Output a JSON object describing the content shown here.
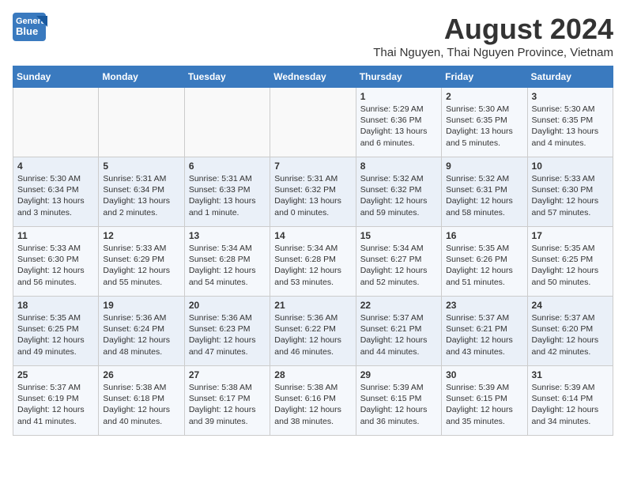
{
  "header": {
    "logo_general": "General",
    "logo_blue": "Blue",
    "main_title": "August 2024",
    "subtitle": "Thai Nguyen, Thai Nguyen Province, Vietnam"
  },
  "calendar": {
    "days_of_week": [
      "Sunday",
      "Monday",
      "Tuesday",
      "Wednesday",
      "Thursday",
      "Friday",
      "Saturday"
    ],
    "weeks": [
      [
        {
          "day": "",
          "info": ""
        },
        {
          "day": "",
          "info": ""
        },
        {
          "day": "",
          "info": ""
        },
        {
          "day": "",
          "info": ""
        },
        {
          "day": "1",
          "info": "Sunrise: 5:29 AM\nSunset: 6:36 PM\nDaylight: 13 hours\nand 6 minutes."
        },
        {
          "day": "2",
          "info": "Sunrise: 5:30 AM\nSunset: 6:35 PM\nDaylight: 13 hours\nand 5 minutes."
        },
        {
          "day": "3",
          "info": "Sunrise: 5:30 AM\nSunset: 6:35 PM\nDaylight: 13 hours\nand 4 minutes."
        }
      ],
      [
        {
          "day": "4",
          "info": "Sunrise: 5:30 AM\nSunset: 6:34 PM\nDaylight: 13 hours\nand 3 minutes."
        },
        {
          "day": "5",
          "info": "Sunrise: 5:31 AM\nSunset: 6:34 PM\nDaylight: 13 hours\nand 2 minutes."
        },
        {
          "day": "6",
          "info": "Sunrise: 5:31 AM\nSunset: 6:33 PM\nDaylight: 13 hours\nand 1 minute."
        },
        {
          "day": "7",
          "info": "Sunrise: 5:31 AM\nSunset: 6:32 PM\nDaylight: 13 hours\nand 0 minutes."
        },
        {
          "day": "8",
          "info": "Sunrise: 5:32 AM\nSunset: 6:32 PM\nDaylight: 12 hours\nand 59 minutes."
        },
        {
          "day": "9",
          "info": "Sunrise: 5:32 AM\nSunset: 6:31 PM\nDaylight: 12 hours\nand 58 minutes."
        },
        {
          "day": "10",
          "info": "Sunrise: 5:33 AM\nSunset: 6:30 PM\nDaylight: 12 hours\nand 57 minutes."
        }
      ],
      [
        {
          "day": "11",
          "info": "Sunrise: 5:33 AM\nSunset: 6:30 PM\nDaylight: 12 hours\nand 56 minutes."
        },
        {
          "day": "12",
          "info": "Sunrise: 5:33 AM\nSunset: 6:29 PM\nDaylight: 12 hours\nand 55 minutes."
        },
        {
          "day": "13",
          "info": "Sunrise: 5:34 AM\nSunset: 6:28 PM\nDaylight: 12 hours\nand 54 minutes."
        },
        {
          "day": "14",
          "info": "Sunrise: 5:34 AM\nSunset: 6:28 PM\nDaylight: 12 hours\nand 53 minutes."
        },
        {
          "day": "15",
          "info": "Sunrise: 5:34 AM\nSunset: 6:27 PM\nDaylight: 12 hours\nand 52 minutes."
        },
        {
          "day": "16",
          "info": "Sunrise: 5:35 AM\nSunset: 6:26 PM\nDaylight: 12 hours\nand 51 minutes."
        },
        {
          "day": "17",
          "info": "Sunrise: 5:35 AM\nSunset: 6:25 PM\nDaylight: 12 hours\nand 50 minutes."
        }
      ],
      [
        {
          "day": "18",
          "info": "Sunrise: 5:35 AM\nSunset: 6:25 PM\nDaylight: 12 hours\nand 49 minutes."
        },
        {
          "day": "19",
          "info": "Sunrise: 5:36 AM\nSunset: 6:24 PM\nDaylight: 12 hours\nand 48 minutes."
        },
        {
          "day": "20",
          "info": "Sunrise: 5:36 AM\nSunset: 6:23 PM\nDaylight: 12 hours\nand 47 minutes."
        },
        {
          "day": "21",
          "info": "Sunrise: 5:36 AM\nSunset: 6:22 PM\nDaylight: 12 hours\nand 46 minutes."
        },
        {
          "day": "22",
          "info": "Sunrise: 5:37 AM\nSunset: 6:21 PM\nDaylight: 12 hours\nand 44 minutes."
        },
        {
          "day": "23",
          "info": "Sunrise: 5:37 AM\nSunset: 6:21 PM\nDaylight: 12 hours\nand 43 minutes."
        },
        {
          "day": "24",
          "info": "Sunrise: 5:37 AM\nSunset: 6:20 PM\nDaylight: 12 hours\nand 42 minutes."
        }
      ],
      [
        {
          "day": "25",
          "info": "Sunrise: 5:37 AM\nSunset: 6:19 PM\nDaylight: 12 hours\nand 41 minutes."
        },
        {
          "day": "26",
          "info": "Sunrise: 5:38 AM\nSunset: 6:18 PM\nDaylight: 12 hours\nand 40 minutes."
        },
        {
          "day": "27",
          "info": "Sunrise: 5:38 AM\nSunset: 6:17 PM\nDaylight: 12 hours\nand 39 minutes."
        },
        {
          "day": "28",
          "info": "Sunrise: 5:38 AM\nSunset: 6:16 PM\nDaylight: 12 hours\nand 38 minutes."
        },
        {
          "day": "29",
          "info": "Sunrise: 5:39 AM\nSunset: 6:15 PM\nDaylight: 12 hours\nand 36 minutes."
        },
        {
          "day": "30",
          "info": "Sunrise: 5:39 AM\nSunset: 6:15 PM\nDaylight: 12 hours\nand 35 minutes."
        },
        {
          "day": "31",
          "info": "Sunrise: 5:39 AM\nSunset: 6:14 PM\nDaylight: 12 hours\nand 34 minutes."
        }
      ]
    ]
  }
}
